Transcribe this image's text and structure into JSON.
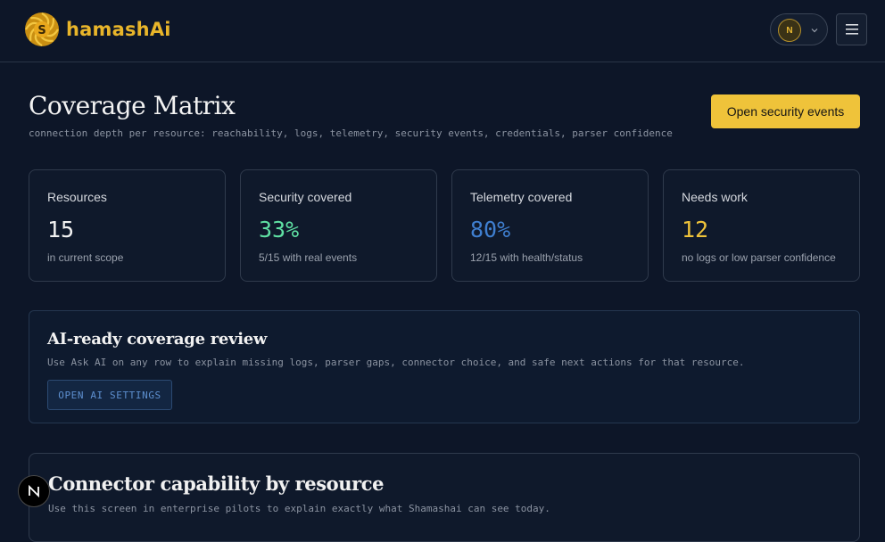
{
  "header": {
    "brand_text": "hamashAi",
    "user_initial": "N",
    "icons": {
      "logo": "swirl-s-logo",
      "user_menu": "chevron-down-icon",
      "menu": "hamburger-icon"
    }
  },
  "page": {
    "title": "Coverage Matrix",
    "subtitle": "connection depth per resource: reachability, logs, telemetry, security events, credentials, parser confidence",
    "primary_action": "Open security events"
  },
  "stats": [
    {
      "label": "Resources",
      "value": "15",
      "caption": "in current scope",
      "color": "#f2f2f2"
    },
    {
      "label": "Security covered",
      "value": "33%",
      "caption": "5/15 with real events",
      "color": "#5fe0a3"
    },
    {
      "label": "Telemetry covered",
      "value": "80%",
      "caption": "12/15 with health/status",
      "color": "#3f7fd0"
    },
    {
      "label": "Needs work",
      "value": "12",
      "caption": "no logs or low parser confidence",
      "color": "#efc33a"
    }
  ],
  "ai_panel": {
    "title": "AI-ready coverage review",
    "description": "Use Ask AI on any row to explain missing logs, parser gaps, connector choice, and safe next actions for that resource.",
    "button": "OPEN AI SETTINGS"
  },
  "connector_panel": {
    "title": "Connector capability by resource",
    "description": "Use this screen in enterprise pilots to explain exactly what Shamashai can see today."
  },
  "dev_badge": {
    "letter": "N"
  }
}
